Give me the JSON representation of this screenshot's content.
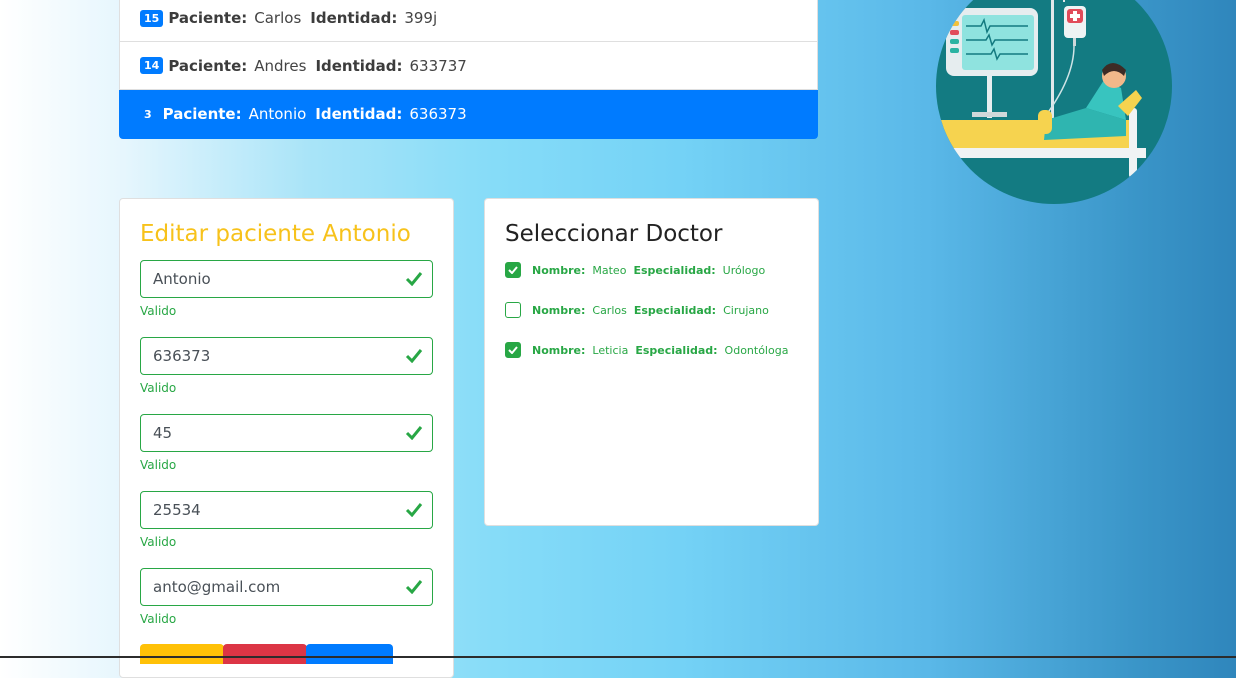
{
  "patients": [
    {
      "badge": "15",
      "paciente_label": "Paciente:",
      "name": "Carlos",
      "identidad_label": "Identidad:",
      "id": "399j",
      "active": false
    },
    {
      "badge": "14",
      "paciente_label": "Paciente:",
      "name": "Andres",
      "identidad_label": "Identidad:",
      "id": "633737",
      "active": false
    },
    {
      "badge": "3",
      "paciente_label": "Paciente:",
      "name": "Antonio",
      "identidad_label": "Identidad:",
      "id": "636373",
      "active": true
    }
  ],
  "edit_form": {
    "title": "Editar paciente Antonio",
    "fields": [
      {
        "value": "Antonio",
        "feedback": "Valido"
      },
      {
        "value": "636373",
        "feedback": "Valido"
      },
      {
        "value": "45",
        "feedback": "Valido"
      },
      {
        "value": "25534",
        "feedback": "Valido"
      },
      {
        "value": "anto@gmail.com",
        "feedback": "Valido"
      }
    ],
    "button_colors": [
      "#ffc107",
      "#dc3545",
      "#007bff"
    ]
  },
  "doctor_panel": {
    "title": "Seleccionar Doctor",
    "nombre_label": "Nombre:",
    "especialidad_label": "Especialidad:",
    "doctors": [
      {
        "name": "Mateo",
        "specialty": "Urólogo",
        "checked": true
      },
      {
        "name": "Carlos",
        "specialty": "Cirujano",
        "checked": false
      },
      {
        "name": "Leticia",
        "specialty": "Odontóloga",
        "checked": true
      }
    ]
  },
  "colors": {
    "primary": "#007bff",
    "success": "#28a745",
    "warning": "#ffc107",
    "danger": "#dc3545",
    "illustration_bg": "#137b82"
  }
}
